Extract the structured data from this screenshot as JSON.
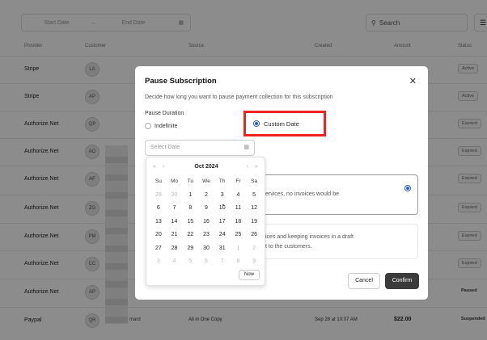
{
  "filter": {
    "start_date": "Start Date",
    "arrow": "→",
    "end_date": "End Date",
    "search_placeholder": "Search"
  },
  "table": {
    "headers": {
      "provider": "Provider",
      "customer": "Customer",
      "source": "Source",
      "created": "Created",
      "amount": "Amount",
      "status": "Status"
    },
    "rows": [
      {
        "provider": "Stripe",
        "initials": "LA",
        "status": "Active"
      },
      {
        "provider": "Stripe",
        "initials": "AP",
        "status": "Active"
      },
      {
        "provider": "Authorize.Net",
        "initials": "QP",
        "status": "Expired"
      },
      {
        "provider": "Authorize.Net",
        "initials": "AO",
        "status": "Expired"
      },
      {
        "provider": "Authorize.Net",
        "initials": "AF",
        "status": "Expired"
      },
      {
        "provider": "Authorize.Net",
        "initials": "ZG",
        "status": "Expired"
      },
      {
        "provider": "Authorize.Net",
        "initials": "PM",
        "status": "Expired"
      },
      {
        "provider": "Authorize.Net",
        "initials": "CC",
        "status": "Expired"
      },
      {
        "provider": "Authorize.Net",
        "initials": "AP",
        "status": "Paused"
      },
      {
        "provider": "Paypal",
        "initials": "QR",
        "customer": "mard",
        "source": "All in One Copy",
        "created": "Sep 28 at 10:07 AM",
        "amount": "$22.00",
        "status": "Suspended"
      }
    ]
  },
  "modal": {
    "title": "Pause Subscription",
    "close": "✕",
    "description": "Decide how long you want to pause payment collection for this subscription",
    "duration_label": "Pause Duration",
    "option_indefinite": "Indefinite",
    "option_custom": "Custom Date",
    "date_placeholder": "Select Date",
    "behavior_option1": "ervices, no invoices would be",
    "behavior_option2_line1": "ices and keeping invoices in a draft",
    "behavior_option2_line2": "t to the customers.",
    "cancel": "Cancel",
    "confirm": "Confirm"
  },
  "calendar": {
    "month": "Oct 2024",
    "prev_year": "«",
    "prev": "‹",
    "next": "›",
    "next_year": "»",
    "weekdays": [
      "Su",
      "Mo",
      "Tu",
      "We",
      "Th",
      "Fr",
      "Sa"
    ],
    "days": [
      [
        "29",
        "30",
        "1",
        "2",
        "3",
        "4",
        "5"
      ],
      [
        "6",
        "7",
        "8",
        "9",
        "10",
        "11",
        "12"
      ],
      [
        "13",
        "14",
        "15",
        "16",
        "17",
        "18",
        "19"
      ],
      [
        "20",
        "21",
        "22",
        "23",
        "24",
        "25",
        "26"
      ],
      [
        "27",
        "28",
        "29",
        "30",
        "31",
        "1",
        "2"
      ],
      [
        "3",
        "4",
        "5",
        "6",
        "7",
        "8",
        "9"
      ]
    ],
    "now": "Now"
  },
  "colors": {
    "highlight": "#ee2222",
    "accent": "#2a64c5",
    "confirm_bg": "#3b3b3b"
  }
}
